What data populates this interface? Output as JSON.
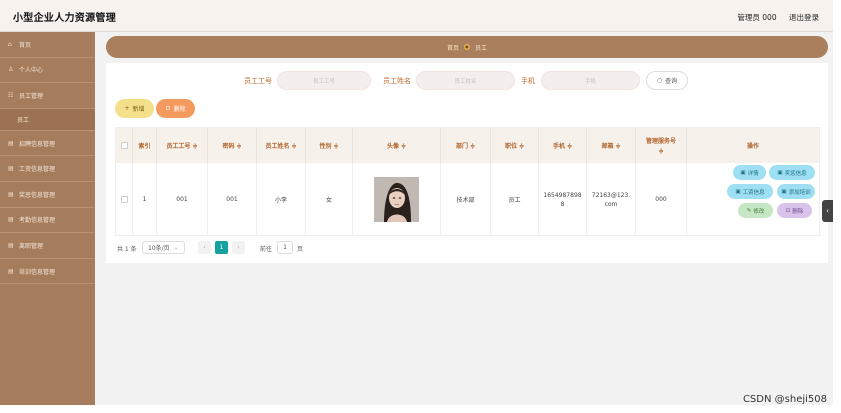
{
  "header": {
    "title": "小型企业人力资源管理",
    "user": "管理员 000",
    "logout": "退出登录"
  },
  "sidebar": {
    "items": [
      {
        "label": "首页",
        "icon": "home-icon"
      },
      {
        "label": "个人中心",
        "icon": "user-icon"
      },
      {
        "label": "员工管理",
        "icon": "users-icon"
      },
      {
        "label": "招聘信息管理",
        "icon": "list-icon"
      },
      {
        "label": "工资信息管理",
        "icon": "list-icon"
      },
      {
        "label": "奖惩信息管理",
        "icon": "list-icon"
      },
      {
        "label": "考勤信息管理",
        "icon": "list-icon"
      },
      {
        "label": "离职管理",
        "icon": "list-icon"
      },
      {
        "label": "培训信息管理",
        "icon": "list-icon"
      }
    ],
    "sub_item": "员工"
  },
  "breadcrumb": {
    "home": "首页",
    "current": "员工"
  },
  "search": {
    "id_label": "员工工号",
    "id_placeholder": "员工工号",
    "name_label": "员工姓名",
    "name_placeholder": "员工姓名",
    "phone_label": "手机",
    "phone_placeholder": "手机",
    "button": "查询"
  },
  "toolbar": {
    "add": "新增",
    "delete": "删除"
  },
  "table": {
    "headers": [
      "索引",
      "员工工号 ≑",
      "密码 ≑",
      "员工姓名 ≑",
      "性别 ≑",
      "头像 ≑",
      "部门 ≑",
      "职位 ≑",
      "手机 ≑",
      "邮箱 ≑",
      "管理服务号",
      "操作"
    ],
    "header_extra": "≑",
    "row": {
      "index": "1",
      "emp_id": "001",
      "password": "001",
      "name": "小李",
      "gender": "女",
      "dept": "技术部",
      "position": "员工",
      "phone_1": "1654987898",
      "phone_2": "8",
      "email_1": "72163@123.",
      "email_2": "com",
      "service": "000"
    },
    "ops": [
      "详情",
      "奖惩信息",
      "工资信息",
      "添加培训",
      "修改",
      "删除"
    ]
  },
  "pager": {
    "total": "共 1 条",
    "size": "10条/页",
    "prev": "‹",
    "page": "1",
    "next": "›",
    "goto": "前往",
    "goto_value": "1",
    "page_suffix": "页"
  },
  "watermark": "CSDN @sheji508",
  "colors": {
    "sidebar": "#a67d5c",
    "accent": "#b0652a",
    "page_active": "#17a2a2"
  }
}
